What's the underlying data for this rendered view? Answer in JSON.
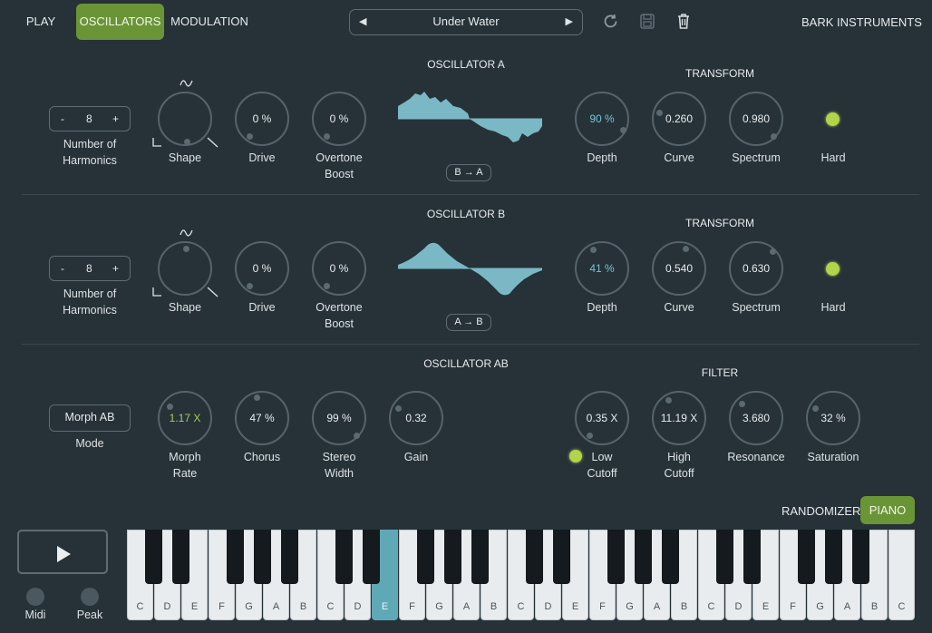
{
  "nav": {
    "play": "PLAY",
    "oscillators": "OSCILLATORS",
    "modulation": "MODULATION"
  },
  "preset": {
    "name": "Under Water",
    "prev": "◀",
    "next": "▶"
  },
  "brand": "BARK INSTRUMENTS",
  "oscA": {
    "title": "OSCILLATOR A",
    "transform_title": "TRANSFORM",
    "harmonics": {
      "minus": "-",
      "value": "8",
      "plus": "+",
      "label1": "Number of",
      "label2": "Harmonics"
    },
    "shape_label": "Shape",
    "drive": {
      "value": "0 %",
      "label": "Drive"
    },
    "overtone": {
      "value": "0 %",
      "label1": "Overtone",
      "label2": "Boost"
    },
    "copy_button": "B → A",
    "depth": {
      "value": "90 %",
      "label": "Depth"
    },
    "curve": {
      "value": "0.260",
      "label": "Curve"
    },
    "spectrum": {
      "value": "0.980",
      "label": "Spectrum"
    },
    "hard_label": "Hard"
  },
  "oscB": {
    "title": "OSCILLATOR B",
    "transform_title": "TRANSFORM",
    "harmonics": {
      "minus": "-",
      "value": "8",
      "plus": "+",
      "label1": "Number of",
      "label2": "Harmonics"
    },
    "shape_label": "Shape",
    "drive": {
      "value": "0 %",
      "label": "Drive"
    },
    "overtone": {
      "value": "0 %",
      "label1": "Overtone",
      "label2": "Boost"
    },
    "copy_button": "A → B",
    "depth": {
      "value": "41 %",
      "label": "Depth"
    },
    "curve": {
      "value": "0.540",
      "label": "Curve"
    },
    "spectrum": {
      "value": "0.630",
      "label": "Spectrum"
    },
    "hard_label": "Hard"
  },
  "oscAB": {
    "title": "OSCILLATOR AB",
    "mode": {
      "value": "Morph AB",
      "label": "Mode"
    },
    "morph_rate": {
      "value": "1.17 X",
      "label1": "Morph",
      "label2": "Rate"
    },
    "chorus": {
      "value": "47 %",
      "label": "Chorus"
    },
    "stereo_width": {
      "value": "99 %",
      "label1": "Stereo",
      "label2": "Width"
    },
    "gain": {
      "value": "0.32",
      "label": "Gain"
    }
  },
  "filter": {
    "title": "FILTER",
    "low_cutoff": {
      "value": "0.35 X",
      "label1": "Low",
      "label2": "Cutoff"
    },
    "high_cutoff": {
      "value": "11.19 X",
      "label1": "High",
      "label2": "Cutoff"
    },
    "resonance": {
      "value": "3.680",
      "label": "Resonance"
    },
    "saturation": {
      "value": "32 %",
      "label": "Saturation"
    }
  },
  "bottom": {
    "randomizer": "RANDOMIZER",
    "piano": "PIANO",
    "midi": "Midi",
    "peak": "Peak"
  },
  "piano": {
    "white_keys": [
      "C",
      "D",
      "E",
      "F",
      "G",
      "A",
      "B",
      "C",
      "D",
      "E",
      "F",
      "G",
      "A",
      "B",
      "C",
      "D",
      "E",
      "F",
      "G",
      "A",
      "B",
      "C",
      "D",
      "E",
      "F",
      "G",
      "A",
      "B",
      "C"
    ],
    "active_key_index": 9
  },
  "colors": {
    "accent_green": "#6a9536",
    "led": "#b2d34a",
    "wave": "#7ab8c6",
    "active_key": "#5fa9b7"
  },
  "icons": {
    "reload": "reload-icon",
    "save": "save-icon",
    "delete": "trash-icon"
  }
}
